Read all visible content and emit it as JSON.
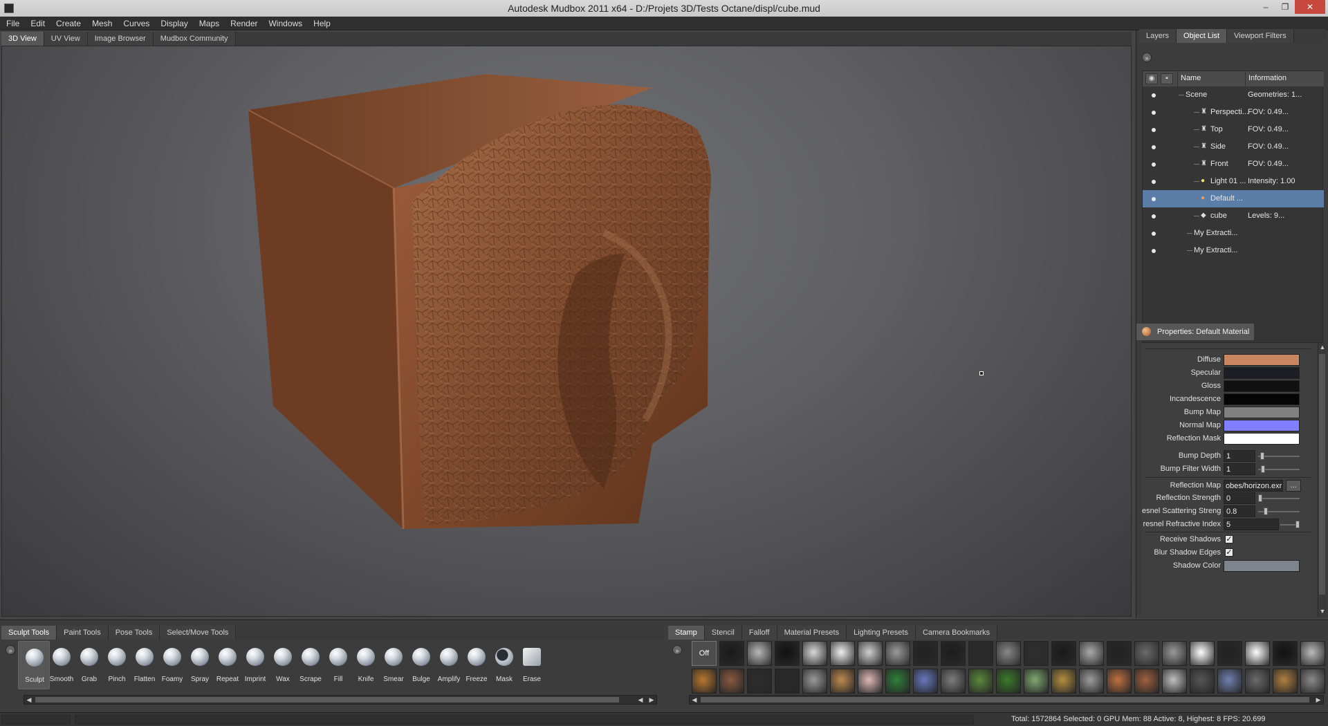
{
  "window": {
    "title": "Autodesk Mudbox 2011 x64 - D:/Projets 3D/Tests Octane/displ/cube.mud",
    "minimize": "–",
    "restore": "❐",
    "close": "✕"
  },
  "menu": [
    "File",
    "Edit",
    "Create",
    "Mesh",
    "Curves",
    "Display",
    "Maps",
    "Render",
    "Windows",
    "Help"
  ],
  "view_tabs": [
    "3D View",
    "UV View",
    "Image Browser",
    "Mudbox Community"
  ],
  "right_tabs": [
    "Layers",
    "Object List",
    "Viewport Filters"
  ],
  "object_list": {
    "columns": {
      "name": "Name",
      "info": "Information"
    },
    "rows": [
      {
        "name": "Scene",
        "info": "Geometries: 1...",
        "icon": "scene-node",
        "indent": 0,
        "selected": false
      },
      {
        "name": "Perspecti...",
        "info": "FOV: 0.49...",
        "icon": "camera-icon",
        "indent": 2,
        "selected": false
      },
      {
        "name": "Top",
        "info": "FOV: 0.49...",
        "icon": "camera-icon",
        "indent": 2,
        "selected": false
      },
      {
        "name": "Side",
        "info": "FOV: 0.49...",
        "icon": "camera-icon",
        "indent": 2,
        "selected": false
      },
      {
        "name": "Front",
        "info": "FOV: 0.49...",
        "icon": "camera-icon",
        "indent": 2,
        "selected": false
      },
      {
        "name": "Light 01 ...",
        "info": "Intensity: 1.00",
        "icon": "light-bulb-icon",
        "indent": 2,
        "selected": false
      },
      {
        "name": "Default ...",
        "info": "",
        "icon": "material-sphere-icon",
        "indent": 2,
        "selected": true
      },
      {
        "name": "cube",
        "info": "Levels: 9...",
        "icon": "mesh-icon",
        "indent": 2,
        "selected": false
      },
      {
        "name": "My Extracti...",
        "info": "",
        "icon": "",
        "indent": 1,
        "selected": false
      },
      {
        "name": "My Extracti...",
        "info": "",
        "icon": "",
        "indent": 1,
        "selected": false
      }
    ]
  },
  "properties": {
    "tab_title": "Properties: Default Material",
    "swatches": [
      {
        "label": "Diffuse",
        "color": "#c98660"
      },
      {
        "label": "Specular",
        "color": "#1b1e22"
      },
      {
        "label": "Gloss",
        "color": "#101010"
      },
      {
        "label": "Incandescence",
        "color": "#050505"
      },
      {
        "label": "Bump Map",
        "color": "#808080"
      },
      {
        "label": "Normal Map",
        "color": "#8080ff"
      },
      {
        "label": "Reflection Mask",
        "color": "#ffffff"
      }
    ],
    "bump_depth": {
      "label": "Bump Depth",
      "value": "1",
      "level": 0.05
    },
    "bump_filter_width": {
      "label": "Bump Filter Width",
      "value": "1",
      "level": 0.08
    },
    "reflection_map": {
      "label": "Reflection Map",
      "value": "obes/horizon.exr",
      "browse": "..."
    },
    "reflection_strength": {
      "label": "Reflection Strength",
      "value": "0",
      "level": 0.0
    },
    "scattering_strength": {
      "label": "esnel Scattering Strength",
      "value": "0.8",
      "level": 0.15
    },
    "refractive_index": {
      "label": "resnel Refractive Index",
      "value": "5",
      "level": 1.0
    },
    "receive_shadows": {
      "label": "Receive Shadows",
      "checked": "✓"
    },
    "blur_shadow_edges": {
      "label": "Blur Shadow Edges",
      "checked": "✓"
    },
    "shadow_color": {
      "label": "Shadow Color",
      "color": "#7e858c"
    }
  },
  "bottom_left_tabs": [
    "Sculpt Tools",
    "Paint Tools",
    "Pose Tools",
    "Select/Move Tools"
  ],
  "sculpt_tools": [
    "Sculpt",
    "Smooth",
    "Grab",
    "Pinch",
    "Flatten",
    "Foamy",
    "Spray",
    "Repeat",
    "Imprint",
    "Wax",
    "Scrape",
    "Fill",
    "Knife",
    "Smear",
    "Bulge",
    "Amplify",
    "Freeze",
    "Mask",
    "Erase"
  ],
  "bottom_right_tabs": [
    "Stamp",
    "Stencil",
    "Falloff",
    "Material Presets",
    "Lighting Presets",
    "Camera Bookmarks"
  ],
  "stamp": {
    "off_label": "Off"
  },
  "status": {
    "stats": "Total: 1572864  Selected: 0 GPU Mem: 88  Active: 8, Highest: 8  FPS: 20.699"
  },
  "colors": {
    "accent_selection": "#5b7ea8",
    "mesh_clay": "#8a5235"
  }
}
